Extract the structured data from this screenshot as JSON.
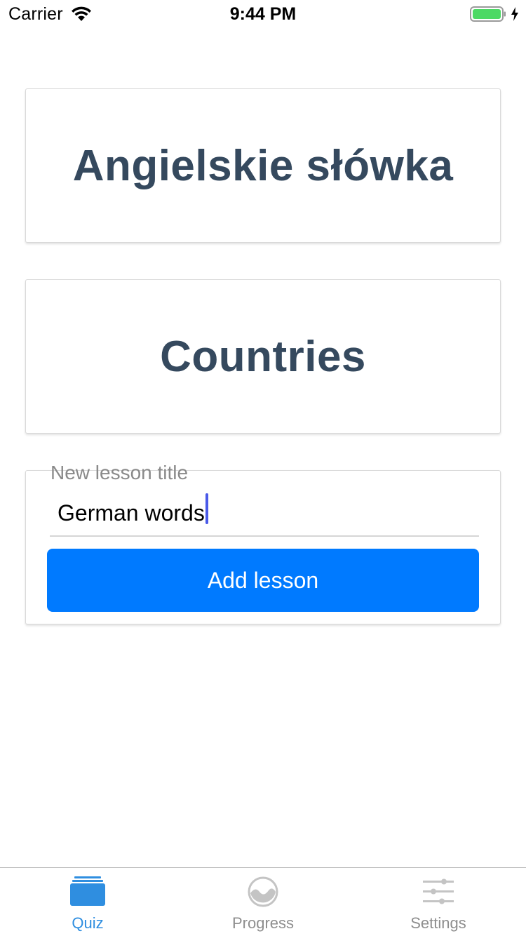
{
  "status_bar": {
    "carrier": "Carrier",
    "time": "9:44 PM",
    "battery_color": "#4cd964"
  },
  "lessons": [
    {
      "title": "Angielskie słówka"
    },
    {
      "title": "Countries"
    }
  ],
  "new_lesson_form": {
    "label": "New lesson title",
    "value": "German words",
    "button_label": "Add lesson",
    "button_color": "#007aff"
  },
  "tab_bar": {
    "tabs": [
      {
        "label": "Quiz",
        "icon": "cards-stack-icon",
        "active": true
      },
      {
        "label": "Progress",
        "icon": "progress-circle-icon",
        "active": false
      },
      {
        "label": "Settings",
        "icon": "sliders-icon",
        "active": false
      }
    ],
    "active_color": "#2f8ee0",
    "inactive_color": "#8e8e8e"
  },
  "colors": {
    "lesson_title": "#35495e"
  }
}
